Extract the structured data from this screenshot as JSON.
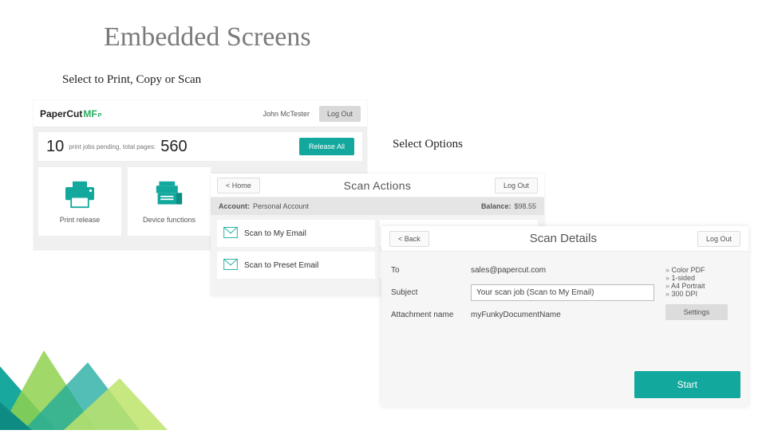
{
  "slide": {
    "title": "Embedded Screens",
    "caption1": "Select to Print, Copy or Scan",
    "caption2": "Select Options"
  },
  "screen1": {
    "brand": {
      "part1": "PaperCut",
      "part2": "MF",
      "sup": "P"
    },
    "user": "John McTester",
    "logout": "Log Out",
    "pending_count": "10",
    "pending_label": "print jobs pending, total pages:",
    "total_pages": "560",
    "release_all": "Release All",
    "tile1": "Print release",
    "tile2": "Device functions"
  },
  "screen2": {
    "home": "< Home",
    "title": "Scan Actions",
    "logout": "Log Out",
    "account_label": "Account:",
    "account_value": "Personal Account",
    "balance_label": "Balance:",
    "balance_value": "$98.55",
    "item1": "Scan to My Email",
    "item2": "Scan to Preset Email"
  },
  "screen3": {
    "back": "< Back",
    "title": "Scan Details",
    "logout": "Log Out",
    "to_label": "To",
    "to_value": "sales@papercut.com",
    "subject_label": "Subject",
    "subject_value": "Your scan job (Scan to My Email)",
    "attach_label": "Attachment name",
    "attach_value": "myFunkyDocumentName",
    "opts": [
      "Color PDF",
      "1-sided",
      "A4 Portrait",
      "300 DPI"
    ],
    "settings": "Settings",
    "start": "Start"
  }
}
